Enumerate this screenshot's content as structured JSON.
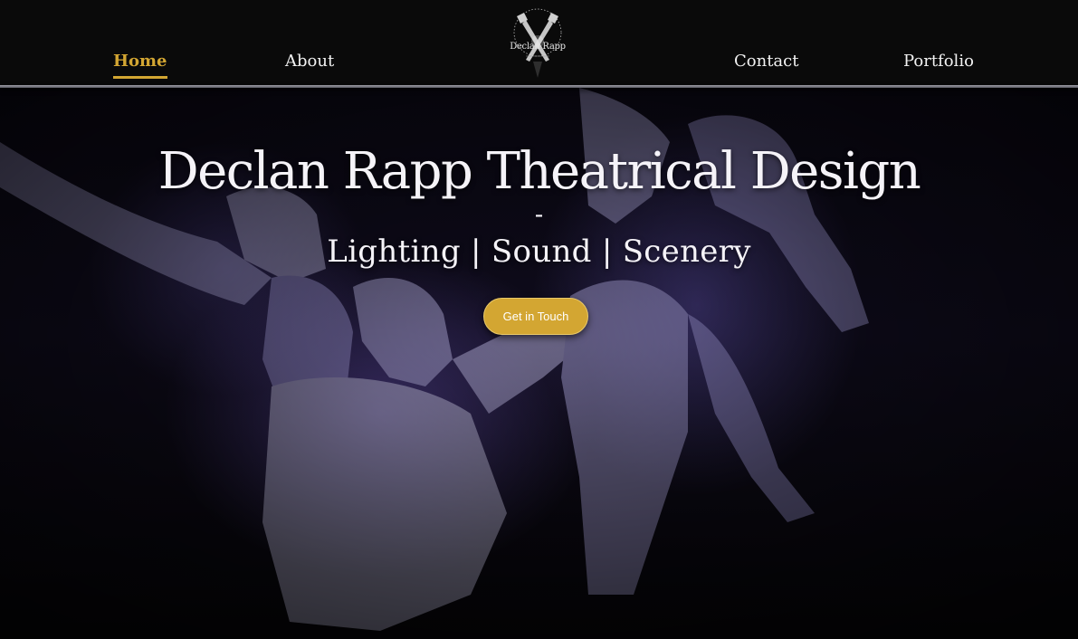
{
  "nav": {
    "items": [
      {
        "label": "Home",
        "active": true
      },
      {
        "label": "About",
        "active": false
      },
      {
        "label": "Contact",
        "active": false
      },
      {
        "label": "Portfolio",
        "active": false
      }
    ]
  },
  "logo": {
    "text": "Declan Rapp"
  },
  "hero": {
    "title": "Declan Rapp Theatrical Design",
    "dash": "-",
    "subtitle": "Lighting | Sound | Scenery",
    "cta_label": "Get in Touch"
  },
  "colors": {
    "accent": "#d3a632",
    "header_bg": "#0a0a0a",
    "text_light": "#f5f3f8"
  }
}
